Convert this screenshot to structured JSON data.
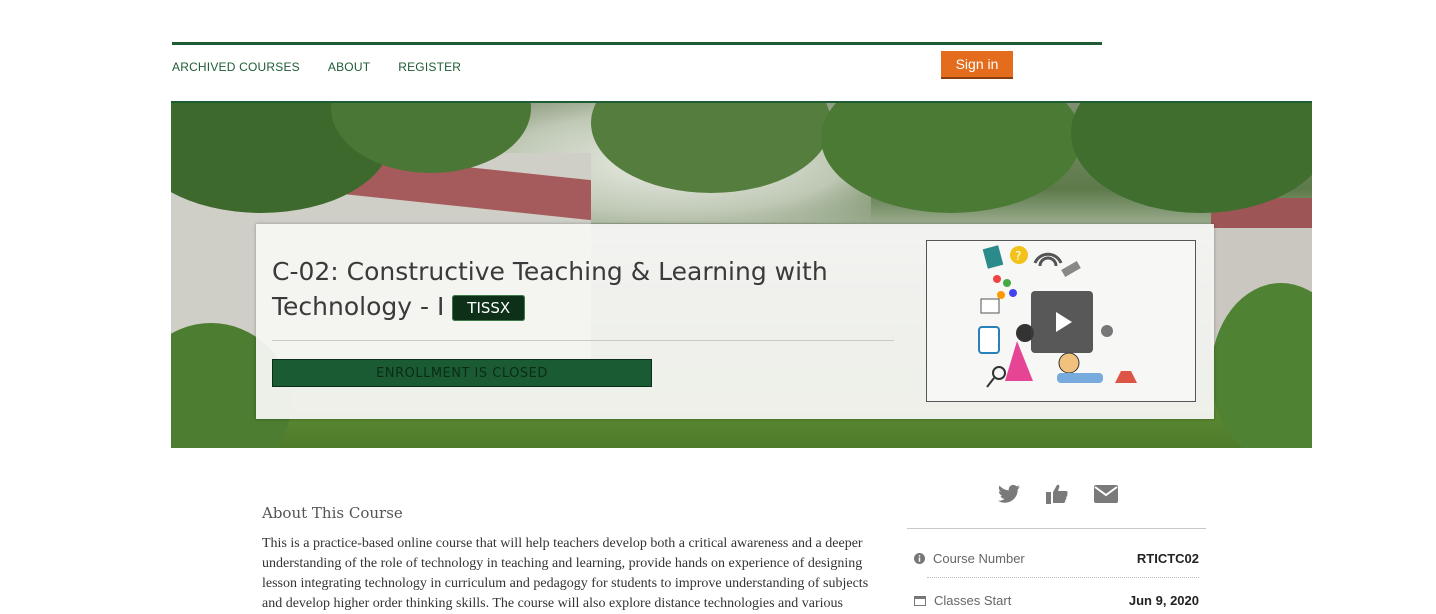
{
  "nav": {
    "archived": "ARCHIVED COURSES",
    "about": "ABOUT",
    "register": "REGISTER"
  },
  "signin_label": "Sign in",
  "course": {
    "title": "C-02: Constructive Teaching & Learning with Technology - I",
    "org_badge": "TISSX",
    "enrollment_status": "ENROLLMENT IS CLOSED"
  },
  "about": {
    "heading": "About This Course",
    "text": "This is a practice-based online course that will help teachers develop both a critical awareness and a deeper understanding of the role of technology in teaching and learning, provide hands on experience of designing lesson integrating technology in curriculum and pedagogy for students to improve understanding of subjects and develop higher order thinking skills. The course will also explore distance technologies and various"
  },
  "share_icons": [
    "twitter-icon",
    "thumbs-up-icon",
    "envelope-icon"
  ],
  "details": [
    {
      "label": "Course Number",
      "value": "RTICTC02",
      "icon": "info-icon"
    },
    {
      "label": "Classes Start",
      "value": "Jun 9, 2020",
      "icon": "calendar-icon"
    }
  ],
  "colors": {
    "brand_green": "#1d5c34",
    "signin_orange": "#e36d1d"
  }
}
